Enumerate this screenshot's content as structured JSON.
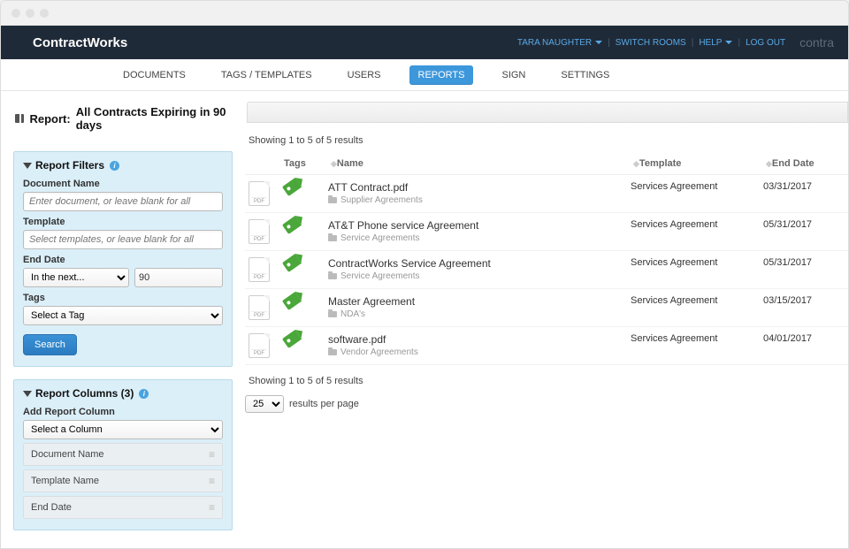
{
  "logo": "ContractWorks",
  "brand_right": "contra",
  "top_links": {
    "user": "TARA NAUGHTER",
    "switch_rooms": "SWITCH ROOMS",
    "help": "HELP",
    "logout": "LOG OUT"
  },
  "nav": {
    "documents": "DOCUMENTS",
    "tags_templates": "TAGS / TEMPLATES",
    "users": "USERS",
    "reports": "REPORTS",
    "sign": "SIGN",
    "settings": "SETTINGS"
  },
  "report": {
    "prefix": "Report:",
    "title": "All Contracts Expiring in 90 days"
  },
  "filters": {
    "heading": "Report Filters",
    "doc_name_label": "Document Name",
    "doc_name_placeholder": "Enter document, or leave blank for all",
    "template_label": "Template",
    "template_placeholder": "Select templates, or leave blank for all",
    "end_date_label": "End Date",
    "end_date_mode": "In the next...",
    "end_date_value": "90",
    "tags_label": "Tags",
    "tags_select": "Select a Tag",
    "search_btn": "Search"
  },
  "columns": {
    "heading": "Report Columns (3)",
    "add_label": "Add Report Column",
    "add_select": "Select a Column",
    "rows": [
      "Document Name",
      "Template Name",
      "End Date"
    ]
  },
  "results": {
    "summary_top": "Showing 1 to 5 of 5 results",
    "summary_bottom": "Showing 1 to 5 of 5 results",
    "per_page_value": "25",
    "per_page_label": "results per page",
    "headers": {
      "tags": "Tags",
      "name": "Name",
      "template": "Template",
      "end_date": "End Date"
    },
    "rows": [
      {
        "name": "ATT Contract.pdf",
        "folder": "Supplier Agreements",
        "template": "Services Agreement",
        "end_date": "03/31/2017"
      },
      {
        "name": "AT&T Phone service Agreement",
        "folder": "Service Agreements",
        "template": "Services Agreement",
        "end_date": "05/31/2017"
      },
      {
        "name": "ContractWorks Service Agreement",
        "folder": "Service Agreements",
        "template": "Services Agreement",
        "end_date": "05/31/2017"
      },
      {
        "name": "Master Agreement",
        "folder": "NDA's",
        "template": "Services Agreement",
        "end_date": "03/15/2017"
      },
      {
        "name": "software.pdf",
        "folder": "Vendor Agreements",
        "template": "Services Agreement",
        "end_date": "04/01/2017"
      }
    ]
  }
}
